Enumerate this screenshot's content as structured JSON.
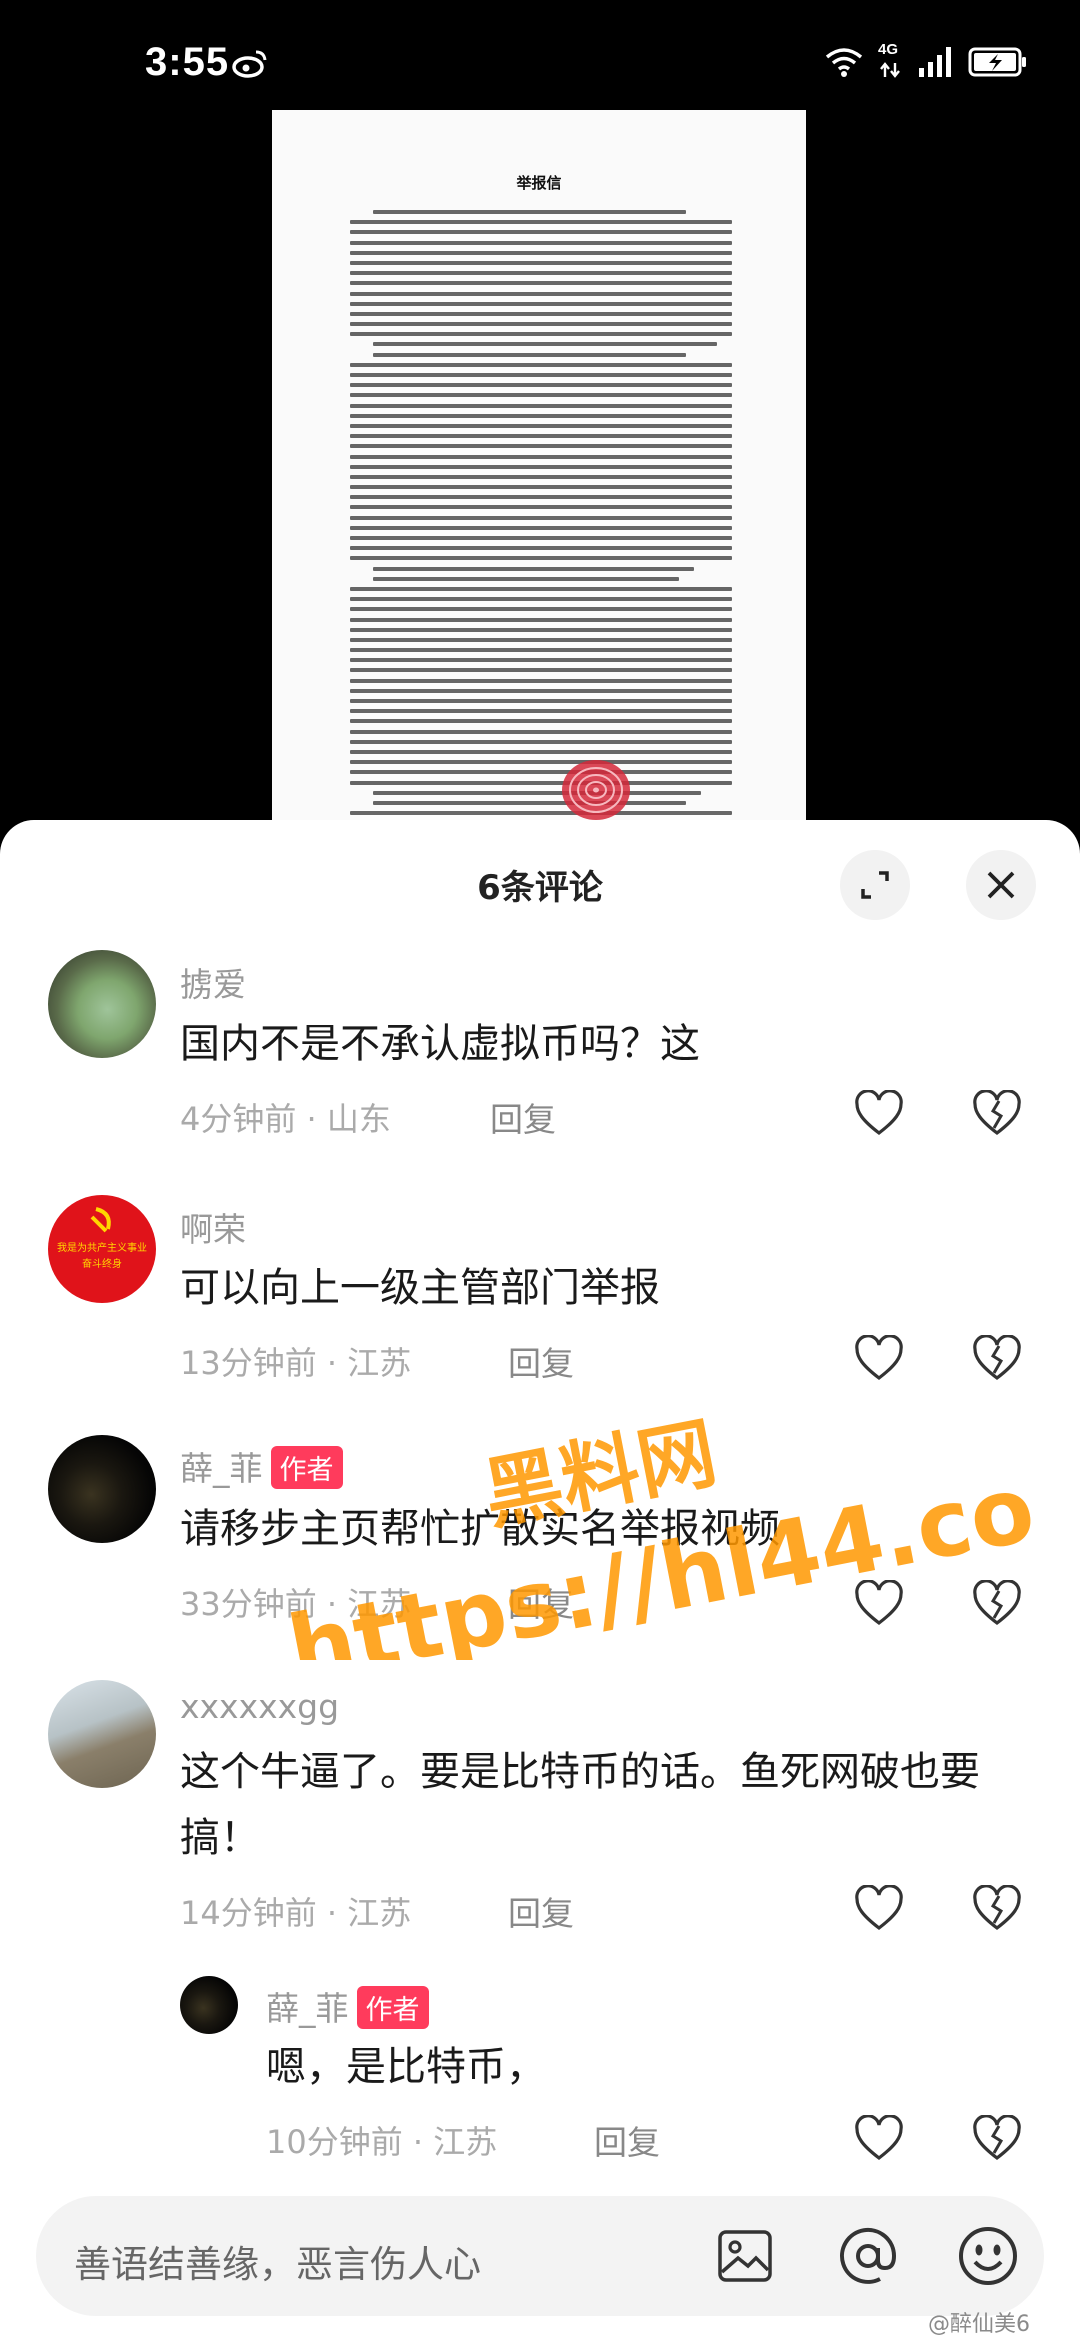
{
  "status_bar": {
    "time": "3:55",
    "network": "4G"
  },
  "document": {
    "title": "举报信"
  },
  "comments_header": {
    "title": "6条评论"
  },
  "comments": [
    {
      "username": "掳爱",
      "text": "国内不是不承认虚拟币吗？这",
      "time": "4分钟前",
      "location": "山东",
      "reply": "回复"
    },
    {
      "username": "啊荣",
      "text": "可以向上一级主管部门举报",
      "time": "13分钟前",
      "location": "江苏",
      "reply": "回复",
      "avatar_text": "我是为共产主义事业奋斗终身"
    },
    {
      "username": "薛_菲",
      "badge": "作者",
      "text": "请移步主页帮忙扩散实名举报视频",
      "time": "33分钟前",
      "location": "江苏",
      "reply": "回复"
    },
    {
      "username": "xxxxxxgg",
      "text": "这个牛逼了。要是比特币的话。鱼死网破也要搞！",
      "time": "14分钟前",
      "location": "江苏",
      "reply": "回复"
    },
    {
      "username": "薛_菲",
      "badge": "作者",
      "text": "嗯，是比特币，",
      "time": "10分钟前",
      "location": "江苏",
      "reply": "回复"
    }
  ],
  "input": {
    "placeholder": "善语结善缘，恶言伤人心"
  },
  "source_watermark": "@醉仙美6",
  "overlay_watermark": {
    "line1": "黑料网",
    "line2": "https://hl44.co"
  },
  "colors": {
    "author_badge": "#ff3b5c",
    "watermark": "#ff9800"
  }
}
